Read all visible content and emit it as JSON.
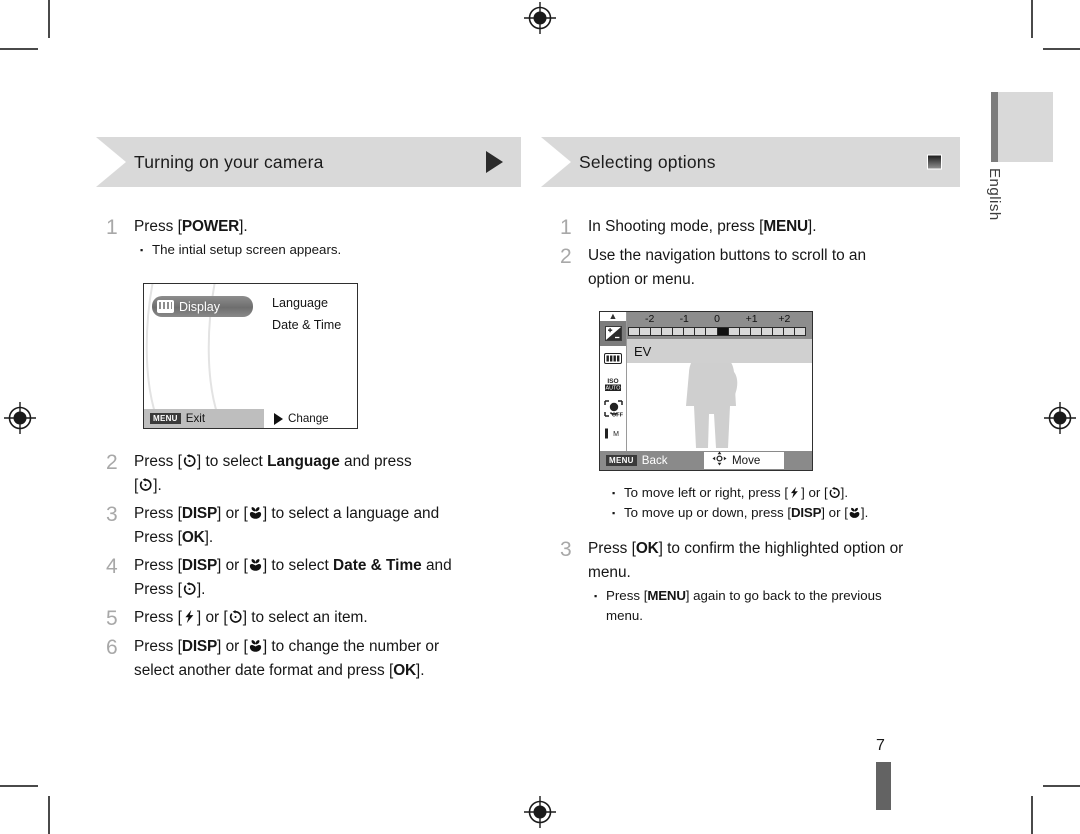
{
  "page": {
    "number": "7",
    "language_tab": "English"
  },
  "left_section": {
    "banner_title": "Turning on your camera",
    "banner_end_marker": "right-triangle",
    "steps": [
      {
        "num": "1",
        "text_html": "Press [<span class=\"key\">POWER</span>].",
        "bullets": [
          "The intial setup screen appears."
        ]
      },
      {
        "num": "2",
        "text_plain": "Press [timer] to select Language and press [timer].",
        "bullets": []
      },
      {
        "num": "3",
        "text_plain": "Press [DISP] or [macro] to select a language and press [OK].",
        "bullets": []
      },
      {
        "num": "4",
        "text_plain": "Press [DISP] or [macro] to select Date & Time and press [timer].",
        "bullets": []
      },
      {
        "num": "5",
        "text_plain": "Press [flash] or [timer] to select an item.",
        "bullets": []
      },
      {
        "num": "6",
        "text_plain": "Press [DISP] or [macro] to change the number or select another date format and press [OK].",
        "bullets": []
      }
    ],
    "words": {
      "press": "Press",
      "to_select": "to select",
      "and_press": "and press",
      "or": "or",
      "language": "Language",
      "date_time": "Date & Time",
      "select_a_language_and": "to select a language and",
      "to_select_an_item": "to select an item.",
      "to_change_the_number_or": "to change the number or",
      "select_another_date_format_and_press": "select another date format and press",
      "disp": "DISP",
      "ok": "OK",
      "power": "POWER",
      "menu": "MENU"
    }
  },
  "right_section": {
    "banner_title": "Selecting options",
    "banner_end_marker": "small-square",
    "steps": [
      {
        "num": "1",
        "text_plain": "In Shooting mode, press [MENU].",
        "bullets": []
      },
      {
        "num": "2",
        "text_plain": "Use the navigation buttons to scroll to an option or menu.",
        "bullets": [
          "To move left or right, press [flash] or [timer].",
          "To move up or down, press [DISP] or [macro]."
        ]
      },
      {
        "num": "3",
        "text_plain": "Press [OK] to confirm the highlighted option or menu.",
        "bullets": [
          "Press [MENU] again to go back to the previous menu."
        ]
      }
    ],
    "words": {
      "in_shooting_mode_press": "In Shooting mode, press",
      "use_nav_1": "Use the navigation buttons to scroll to an",
      "use_nav_2": "option or menu.",
      "move_lr": "To move left or right, press",
      "move_ud": "To move up or down, press",
      "confirm_1": "to confirm the highlighted option or",
      "confirm_2": "menu.",
      "again_back_1": "again to go back to the previous",
      "again_back_2": "menu.",
      "press": "Press",
      "or": "or",
      "menu": "MENU",
      "disp": "DISP",
      "ok": "OK"
    }
  },
  "lcd_setup": {
    "tab_label": "Display",
    "tab_icon": "monitor-icon",
    "menu_items": [
      "Language",
      "Date & Time"
    ],
    "bar_badge": "MENU",
    "bar_left_label": "Exit",
    "bar_right_label": "Change",
    "bar_right_icon": "right-triangle-icon"
  },
  "lcd_shooting": {
    "ev_label": "EV",
    "ev_scale_labels": [
      "-2",
      "-1",
      "0",
      "+1",
      "+2"
    ],
    "ev_segments": 16,
    "ev_selected_segment": 8,
    "bar_badge": "MENU",
    "bar_left_label": "Back",
    "bar_right_label": "Move",
    "bar_right_icon": "four-way-nav-icon",
    "side_icons": [
      "ev-compensation-icon",
      "white-balance-icon",
      "iso-auto-icon",
      "face-detection-off-icon",
      "image-quality-icon",
      "focus-area-icon",
      "flash-off-icon"
    ],
    "scroll_up_icon": "chevron-up-icon",
    "scroll_down_icon": "chevron-down-icon",
    "subject": "person-silhouette"
  },
  "colors": {
    "banner_bg": "#d9d9d9",
    "step_number": "#a8a8a8",
    "text": "#161616",
    "lcd_bar_light": "#bebebe",
    "lcd_bar_dark": "#8a8a8a",
    "ev_strip": "#8d8d8d",
    "ev_row": "#d0d0d0",
    "icon_selected": "#7d7d7d",
    "silhouette": "#cfcfcf",
    "page_bar": "#636363",
    "lang_bar": "#7c7c7c",
    "crop_mark": "#4a4a4a"
  }
}
